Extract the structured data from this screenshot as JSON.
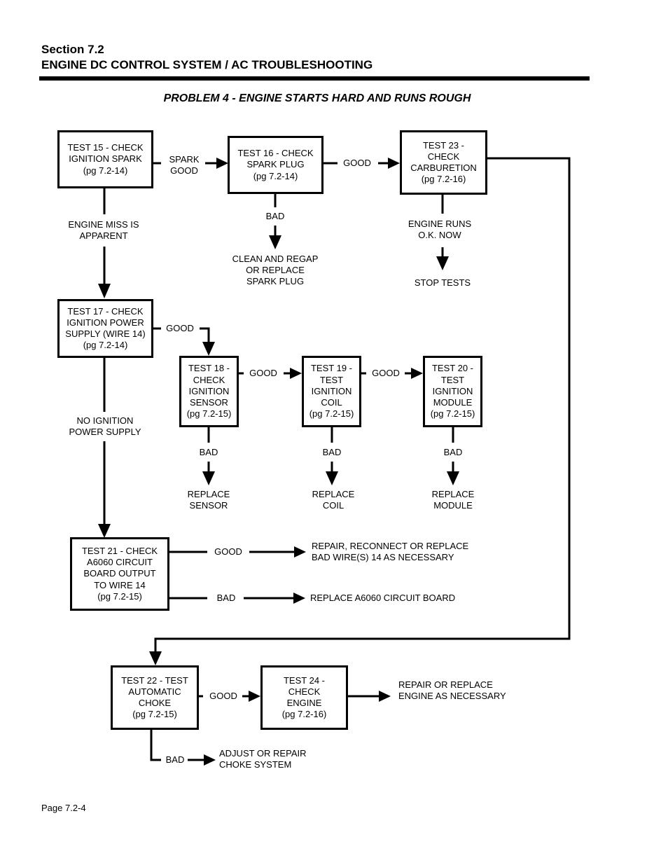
{
  "header": {
    "section": "Section 7.2",
    "subtitle": "ENGINE DC CONTROL SYSTEM / AC TROUBLESHOOTING"
  },
  "title": "PROBLEM 4 - ENGINE STARTS HARD AND RUNS ROUGH",
  "footer": {
    "page": "Page 7.2-4"
  },
  "boxes": {
    "test15": "TEST 15 - CHECK\nIGNITION SPARK\n(pg 7.2-14)",
    "test16": "TEST 16 - CHECK\nSPARK PLUG\n(pg 7.2-14)",
    "test23": "TEST 23 -\nCHECK\nCARBURETION\n(pg 7.2-16)",
    "test17": "TEST 17 - CHECK\nIGNITION POWER\nSUPPLY (WIRE 14)\n(pg 7.2-14)",
    "test18": "TEST 18 -\nCHECK\nIGNITION\nSENSOR\n(pg 7.2-15)",
    "test19": "TEST 19 -\nTEST\nIGNITION\nCOIL\n(pg 7.2-15)",
    "test20": "TEST 20 -\nTEST\nIGNITION\nMODULE\n(pg 7.2-15)",
    "test21": "TEST 21 - CHECK\nA6060 CIRCUIT\nBOARD OUTPUT\nTO WIRE 14\n(pg 7.2-15)",
    "test22": "TEST 22 - TEST\nAUTOMATIC\nCHOKE\n(pg 7.2-15)",
    "test24": "TEST 24 -\nCHECK\nENGINE\n(pg 7.2-16)"
  },
  "labels": {
    "spark_good": "SPARK\nGOOD",
    "good_16_23": "GOOD",
    "bad_16": "BAD",
    "result_16": "CLEAN AND REGAP\nOR REPLACE\nSPARK PLUG",
    "engine_miss": "ENGINE MISS IS\nAPPARENT",
    "engine_runs_ok": "ENGINE RUNS\nO.K. NOW",
    "stop_tests": "STOP TESTS",
    "good_17_18": "GOOD",
    "good_18_19": "GOOD",
    "good_19_20": "GOOD",
    "bad_18": "BAD",
    "bad_19": "BAD",
    "bad_20": "BAD",
    "replace_sensor": "REPLACE\nSENSOR",
    "replace_coil": "REPLACE\nCOIL",
    "replace_module": "REPLACE\nMODULE",
    "no_ignition_power": "NO IGNITION\nPOWER SUPPLY",
    "good_21": "GOOD",
    "result_21_good": "REPAIR, RECONNECT OR REPLACE\nBAD WIRE(S) 14 AS NECESSARY",
    "bad_21": "BAD",
    "result_21_bad": "REPLACE A6060 CIRCUIT BOARD",
    "good_22_24": "GOOD",
    "result_24": "REPAIR OR REPLACE\nENGINE AS NECESSARY",
    "bad_22": "BAD",
    "result_22_bad": "ADJUST OR REPAIR\nCHOKE SYSTEM"
  }
}
